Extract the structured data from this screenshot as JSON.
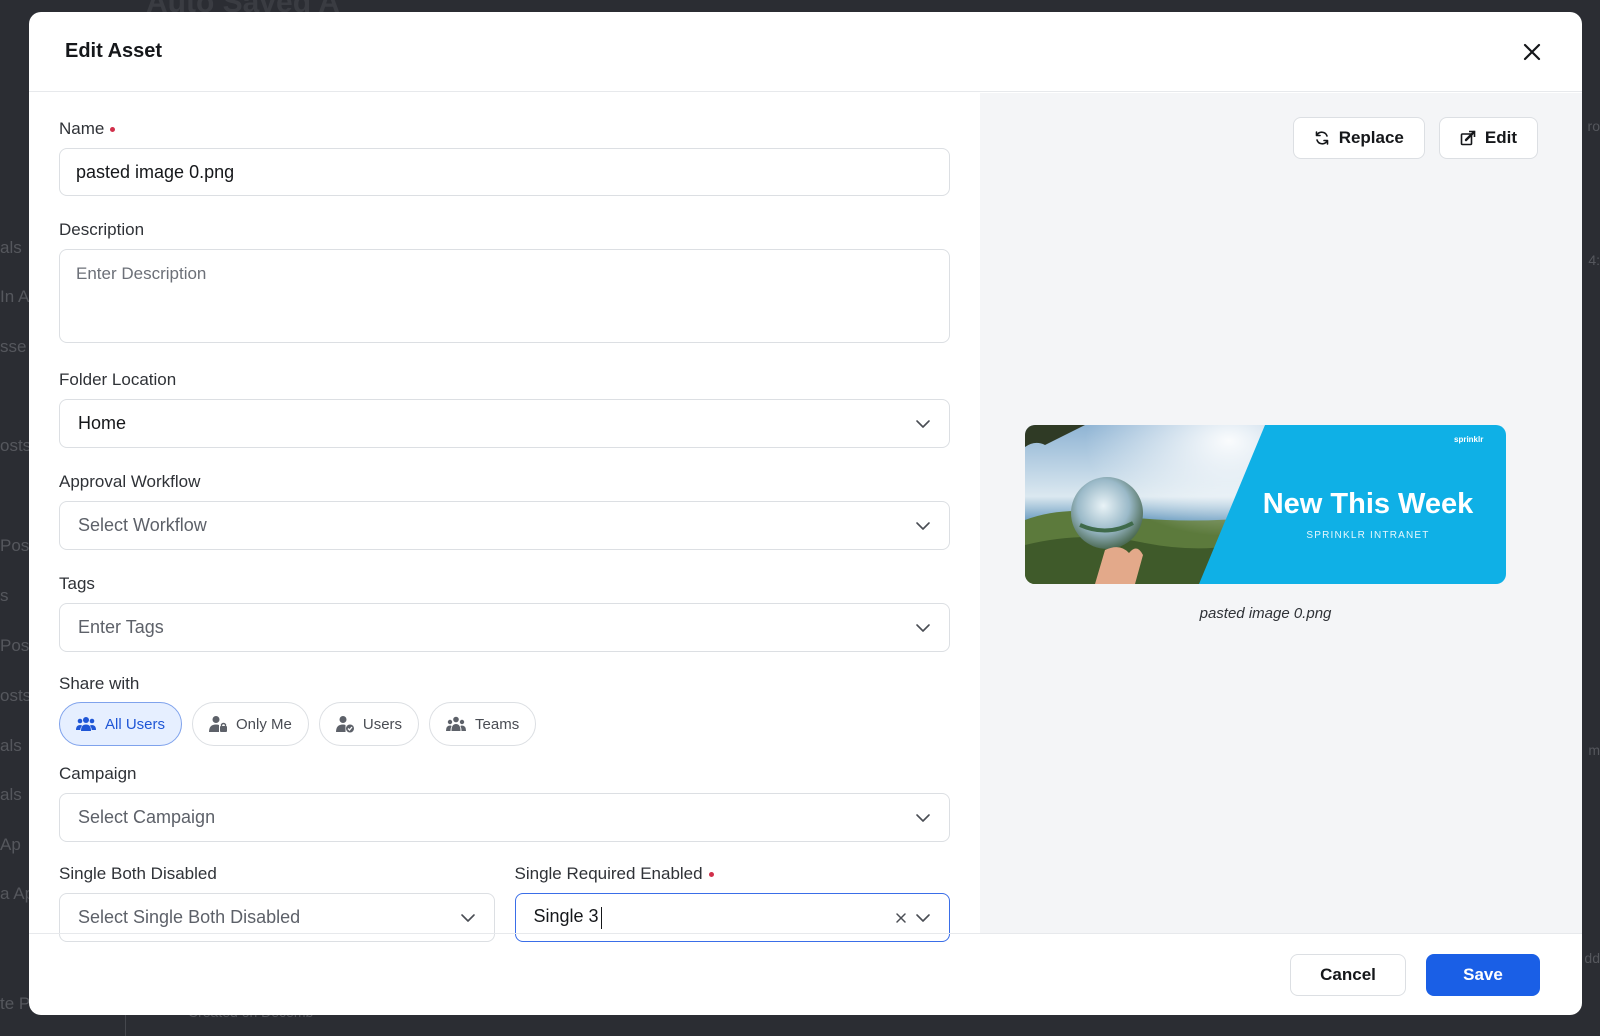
{
  "background": {
    "page_title": "Auto Saved A",
    "left_fragments": [
      "als",
      "In A",
      "sse",
      "osts",
      "Pos",
      "s",
      "Pos",
      "osts",
      "als",
      "als",
      "Ap",
      "a Ap",
      "te Post"
    ],
    "right_fragments": [
      "ro",
      "4:",
      "m",
      "dd"
    ],
    "bottom_fragment": "Created on Decemb"
  },
  "modal": {
    "title": "Edit Asset",
    "close_icon": "close-icon"
  },
  "form": {
    "name": {
      "label": "Name",
      "value": "pasted image 0.png"
    },
    "description": {
      "label": "Description",
      "placeholder": "Enter Description"
    },
    "folder_location": {
      "label": "Folder Location",
      "value": "Home"
    },
    "approval_workflow": {
      "label": "Approval Workflow",
      "placeholder": "Select Workflow"
    },
    "tags": {
      "label": "Tags",
      "placeholder": "Enter Tags"
    },
    "share_with": {
      "label": "Share with",
      "options": [
        {
          "label": "All Users",
          "icon": "users-group-icon",
          "active": true
        },
        {
          "label": "Only Me",
          "icon": "user-lock-icon",
          "active": false
        },
        {
          "label": "Users",
          "icon": "user-check-icon",
          "active": false
        },
        {
          "label": "Teams",
          "icon": "team-icon",
          "active": false
        }
      ]
    },
    "campaign": {
      "label": "Campaign",
      "placeholder": "Select Campaign"
    },
    "single_both_disabled": {
      "label": "Single Both Disabled",
      "placeholder": "Select Single Both Disabled"
    },
    "single_required_enabled": {
      "label": "Single Required Enabled",
      "value": "Single 3"
    }
  },
  "preview": {
    "replace_label": "Replace",
    "edit_label": "Edit",
    "image": {
      "headline": "New This Week",
      "subline": "SPRINKLR INTRANET",
      "brand": "sprinklr"
    },
    "caption": "pasted image 0.png"
  },
  "footer": {
    "cancel_label": "Cancel",
    "save_label": "Save"
  },
  "colors": {
    "primary": "#1a5fe6",
    "required": "#d1304b",
    "chip_active_bg": "#e6efff",
    "banner_blue": "#0fb0e6"
  }
}
